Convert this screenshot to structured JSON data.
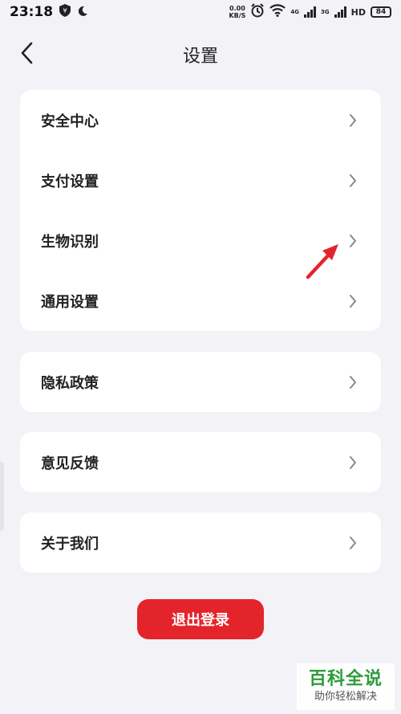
{
  "status_bar": {
    "time": "23:18",
    "net_speed_value": "0.00",
    "net_speed_unit": "KB/S",
    "network_4g": "4G",
    "network_3g": "3G",
    "hd": "HD",
    "battery": "84"
  },
  "header": {
    "title": "设置"
  },
  "groups": [
    {
      "items": [
        {
          "label": "安全中心"
        },
        {
          "label": "支付设置"
        },
        {
          "label": "生物识别"
        },
        {
          "label": "通用设置"
        }
      ]
    },
    {
      "items": [
        {
          "label": "隐私政策"
        }
      ]
    },
    {
      "items": [
        {
          "label": "意见反馈"
        }
      ]
    },
    {
      "items": [
        {
          "label": "关于我们"
        }
      ]
    }
  ],
  "logout": {
    "label": "退出登录"
  },
  "watermark": {
    "title": "百科全说",
    "subtitle": "助你轻松解决"
  },
  "colors": {
    "accent": "#e4242b",
    "background": "#f3f2f7",
    "card": "#ffffff",
    "annotation": "#e4242b",
    "watermark": "#2e9b3b"
  },
  "icons": {
    "back": "chevron-left-icon",
    "row": "chevron-right-icon",
    "annotation": "red-arrow-icon"
  }
}
